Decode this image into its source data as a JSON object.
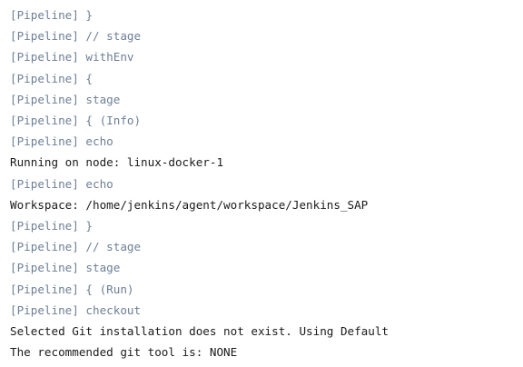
{
  "console": {
    "lines": [
      {
        "text": "[Pipeline] }",
        "type": "pipeline"
      },
      {
        "text": "[Pipeline] // stage",
        "type": "pipeline"
      },
      {
        "text": "[Pipeline] withEnv",
        "type": "pipeline"
      },
      {
        "text": "[Pipeline] {",
        "type": "pipeline"
      },
      {
        "text": "[Pipeline] stage",
        "type": "pipeline"
      },
      {
        "text": "[Pipeline] { (Info)",
        "type": "pipeline"
      },
      {
        "text": "[Pipeline] echo",
        "type": "pipeline"
      },
      {
        "text": "Running on node: linux-docker-1",
        "type": "output"
      },
      {
        "text": "[Pipeline] echo",
        "type": "pipeline"
      },
      {
        "text": "Workspace: /home/jenkins/agent/workspace/Jenkins_SAP",
        "type": "output"
      },
      {
        "text": "[Pipeline] }",
        "type": "pipeline"
      },
      {
        "text": "[Pipeline] // stage",
        "type": "pipeline"
      },
      {
        "text": "[Pipeline] stage",
        "type": "pipeline"
      },
      {
        "text": "[Pipeline] { (Run)",
        "type": "pipeline"
      },
      {
        "text": "[Pipeline] checkout",
        "type": "pipeline"
      },
      {
        "text": "Selected Git installation does not exist. Using Default",
        "type": "output"
      },
      {
        "text": "The recommended git tool is: NONE",
        "type": "output"
      }
    ],
    "colors": {
      "background": "#ffffff",
      "pipeline_text": "#6e7f96",
      "output_text": "#1b1b1b"
    }
  }
}
